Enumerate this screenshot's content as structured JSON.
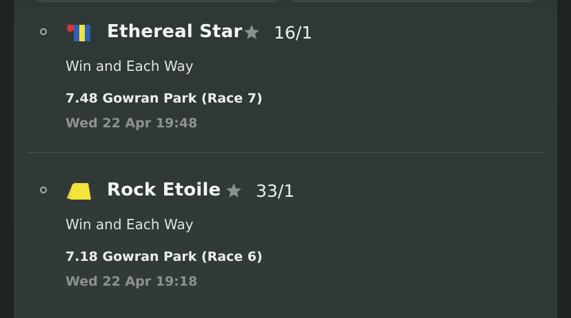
{
  "selections": [
    {
      "horse_name": "Ethereal Star",
      "odds": "16/1",
      "bet_type": "Win and Each Way",
      "race": "7.48 Gowran Park (Race 7)",
      "datetime": "Wed 22 Apr 19:48",
      "silks_icon": "silks-red-blue-yellow-icon",
      "favourite_icon": "star-icon"
    },
    {
      "horse_name": "Rock Etoile",
      "odds": "33/1",
      "bet_type": "Win and Each Way",
      "race": "7.18 Gowran Park (Race 6)",
      "datetime": "Wed 22 Apr 19:18",
      "silks_icon": "silks-yellow-icon",
      "favourite_icon": "star-icon"
    }
  ],
  "colors": {
    "panel_background": "#313937",
    "text_primary": "#f4f5f5",
    "text_secondary": "#8d9291",
    "star_icon": "#8a8f8e",
    "silks_yellow": "#f2e43a",
    "silks_blue": "#2f5fb8",
    "silks_red": "#d23a36"
  }
}
